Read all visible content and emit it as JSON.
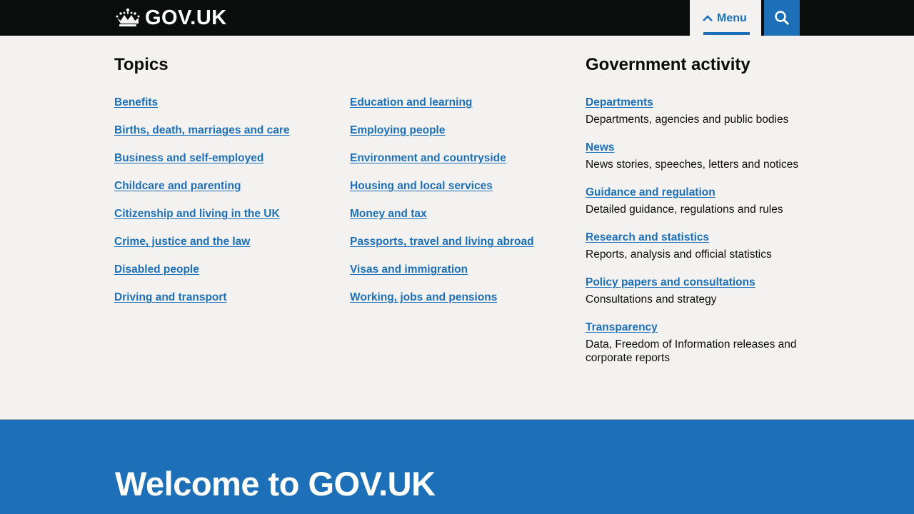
{
  "header": {
    "logo_text": "GOV.UK",
    "menu_label": "Menu",
    "search_label": "Search"
  },
  "topics": {
    "title": "Topics",
    "column_1": [
      "Benefits",
      "Births, death, marriages and care",
      "Business and self-employed",
      "Childcare and parenting",
      "Citizenship and living in the UK",
      "Crime, justice and the law",
      "Disabled people",
      "Driving and transport"
    ],
    "column_2": [
      "Education and learning",
      "Employing people",
      "Environment and countryside",
      "Housing and local services",
      "Money and tax",
      "Passports, travel and living abroad",
      "Visas and immigration",
      "Working, jobs and pensions"
    ]
  },
  "government_activity": {
    "title": "Government activity",
    "items": [
      {
        "label": "Departments",
        "description": "Departments, agencies and public bodies"
      },
      {
        "label": "News",
        "description": "News stories, speeches, letters and notices"
      },
      {
        "label": "Guidance and regulation",
        "description": "Detailed guidance, regulations and rules"
      },
      {
        "label": "Research and statistics",
        "description": "Reports, analysis and official statistics"
      },
      {
        "label": "Policy papers and consultations",
        "description": "Consultations and strategy"
      },
      {
        "label": "Transparency",
        "description": "Data, Freedom of Information releases and corporate reports"
      }
    ]
  },
  "hero": {
    "title": "Welcome to GOV.UK"
  },
  "colors": {
    "header_bg": "#0b0c0c",
    "link": "#1d70b8",
    "page_bg": "#f3f2f1",
    "hero_bg": "#1d70b8",
    "text": "#0b0c0c"
  },
  "icons": {
    "logo": "crown-icon",
    "menu": "chevron-up-icon",
    "search": "search-icon"
  }
}
